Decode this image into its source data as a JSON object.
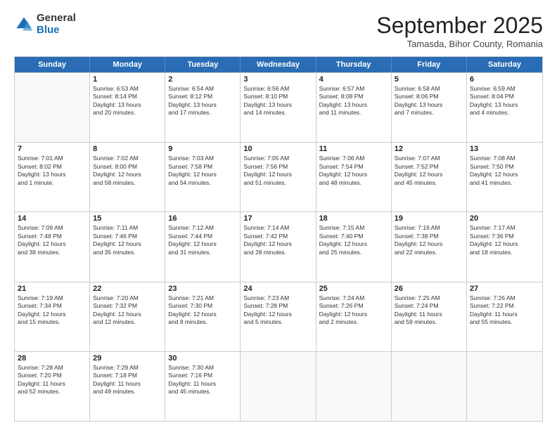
{
  "logo": {
    "general": "General",
    "blue": "Blue"
  },
  "header": {
    "month": "September 2025",
    "location": "Tamasda, Bihor County, Romania"
  },
  "weekdays": [
    "Sunday",
    "Monday",
    "Tuesday",
    "Wednesday",
    "Thursday",
    "Friday",
    "Saturday"
  ],
  "rows": [
    [
      {
        "day": "",
        "lines": []
      },
      {
        "day": "1",
        "lines": [
          "Sunrise: 6:53 AM",
          "Sunset: 8:14 PM",
          "Daylight: 13 hours",
          "and 20 minutes."
        ]
      },
      {
        "day": "2",
        "lines": [
          "Sunrise: 6:54 AM",
          "Sunset: 8:12 PM",
          "Daylight: 13 hours",
          "and 17 minutes."
        ]
      },
      {
        "day": "3",
        "lines": [
          "Sunrise: 6:56 AM",
          "Sunset: 8:10 PM",
          "Daylight: 13 hours",
          "and 14 minutes."
        ]
      },
      {
        "day": "4",
        "lines": [
          "Sunrise: 6:57 AM",
          "Sunset: 8:08 PM",
          "Daylight: 13 hours",
          "and 11 minutes."
        ]
      },
      {
        "day": "5",
        "lines": [
          "Sunrise: 6:58 AM",
          "Sunset: 8:06 PM",
          "Daylight: 13 hours",
          "and 7 minutes."
        ]
      },
      {
        "day": "6",
        "lines": [
          "Sunrise: 6:59 AM",
          "Sunset: 8:04 PM",
          "Daylight: 13 hours",
          "and 4 minutes."
        ]
      }
    ],
    [
      {
        "day": "7",
        "lines": [
          "Sunrise: 7:01 AM",
          "Sunset: 8:02 PM",
          "Daylight: 13 hours",
          "and 1 minute."
        ]
      },
      {
        "day": "8",
        "lines": [
          "Sunrise: 7:02 AM",
          "Sunset: 8:00 PM",
          "Daylight: 12 hours",
          "and 58 minutes."
        ]
      },
      {
        "day": "9",
        "lines": [
          "Sunrise: 7:03 AM",
          "Sunset: 7:58 PM",
          "Daylight: 12 hours",
          "and 54 minutes."
        ]
      },
      {
        "day": "10",
        "lines": [
          "Sunrise: 7:05 AM",
          "Sunset: 7:56 PM",
          "Daylight: 12 hours",
          "and 51 minutes."
        ]
      },
      {
        "day": "11",
        "lines": [
          "Sunrise: 7:06 AM",
          "Sunset: 7:54 PM",
          "Daylight: 12 hours",
          "and 48 minutes."
        ]
      },
      {
        "day": "12",
        "lines": [
          "Sunrise: 7:07 AM",
          "Sunset: 7:52 PM",
          "Daylight: 12 hours",
          "and 45 minutes."
        ]
      },
      {
        "day": "13",
        "lines": [
          "Sunrise: 7:08 AM",
          "Sunset: 7:50 PM",
          "Daylight: 12 hours",
          "and 41 minutes."
        ]
      }
    ],
    [
      {
        "day": "14",
        "lines": [
          "Sunrise: 7:09 AM",
          "Sunset: 7:48 PM",
          "Daylight: 12 hours",
          "and 38 minutes."
        ]
      },
      {
        "day": "15",
        "lines": [
          "Sunrise: 7:11 AM",
          "Sunset: 7:46 PM",
          "Daylight: 12 hours",
          "and 35 minutes."
        ]
      },
      {
        "day": "16",
        "lines": [
          "Sunrise: 7:12 AM",
          "Sunset: 7:44 PM",
          "Daylight: 12 hours",
          "and 31 minutes."
        ]
      },
      {
        "day": "17",
        "lines": [
          "Sunrise: 7:14 AM",
          "Sunset: 7:42 PM",
          "Daylight: 12 hours",
          "and 28 minutes."
        ]
      },
      {
        "day": "18",
        "lines": [
          "Sunrise: 7:15 AM",
          "Sunset: 7:40 PM",
          "Daylight: 12 hours",
          "and 25 minutes."
        ]
      },
      {
        "day": "19",
        "lines": [
          "Sunrise: 7:16 AM",
          "Sunset: 7:38 PM",
          "Daylight: 12 hours",
          "and 22 minutes."
        ]
      },
      {
        "day": "20",
        "lines": [
          "Sunrise: 7:17 AM",
          "Sunset: 7:36 PM",
          "Daylight: 12 hours",
          "and 18 minutes."
        ]
      }
    ],
    [
      {
        "day": "21",
        "lines": [
          "Sunrise: 7:19 AM",
          "Sunset: 7:34 PM",
          "Daylight: 12 hours",
          "and 15 minutes."
        ]
      },
      {
        "day": "22",
        "lines": [
          "Sunrise: 7:20 AM",
          "Sunset: 7:32 PM",
          "Daylight: 12 hours",
          "and 12 minutes."
        ]
      },
      {
        "day": "23",
        "lines": [
          "Sunrise: 7:21 AM",
          "Sunset: 7:30 PM",
          "Daylight: 12 hours",
          "and 8 minutes."
        ]
      },
      {
        "day": "24",
        "lines": [
          "Sunrise: 7:23 AM",
          "Sunset: 7:28 PM",
          "Daylight: 12 hours",
          "and 5 minutes."
        ]
      },
      {
        "day": "25",
        "lines": [
          "Sunrise: 7:24 AM",
          "Sunset: 7:26 PM",
          "Daylight: 12 hours",
          "and 2 minutes."
        ]
      },
      {
        "day": "26",
        "lines": [
          "Sunrise: 7:25 AM",
          "Sunset: 7:24 PM",
          "Daylight: 11 hours",
          "and 59 minutes."
        ]
      },
      {
        "day": "27",
        "lines": [
          "Sunrise: 7:26 AM",
          "Sunset: 7:22 PM",
          "Daylight: 11 hours",
          "and 55 minutes."
        ]
      }
    ],
    [
      {
        "day": "28",
        "lines": [
          "Sunrise: 7:28 AM",
          "Sunset: 7:20 PM",
          "Daylight: 11 hours",
          "and 52 minutes."
        ]
      },
      {
        "day": "29",
        "lines": [
          "Sunrise: 7:29 AM",
          "Sunset: 7:18 PM",
          "Daylight: 11 hours",
          "and 49 minutes."
        ]
      },
      {
        "day": "30",
        "lines": [
          "Sunrise: 7:30 AM",
          "Sunset: 7:16 PM",
          "Daylight: 11 hours",
          "and 45 minutes."
        ]
      },
      {
        "day": "",
        "lines": []
      },
      {
        "day": "",
        "lines": []
      },
      {
        "day": "",
        "lines": []
      },
      {
        "day": "",
        "lines": []
      }
    ]
  ]
}
